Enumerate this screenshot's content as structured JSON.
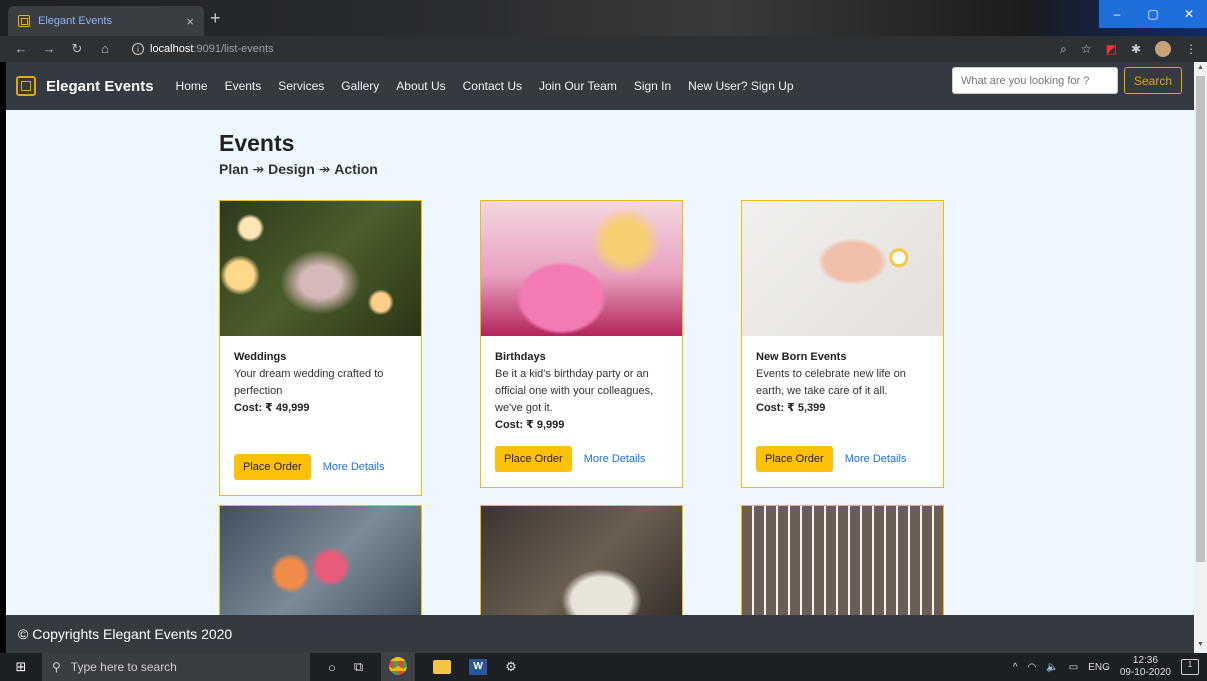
{
  "browser": {
    "tab_title": "Elegant Events",
    "tab_close": "×",
    "new_tab": "+",
    "url_host": "localhost",
    "url_rest": ":9091/list-events",
    "window_controls": [
      "–",
      "▢",
      "✕"
    ]
  },
  "site": {
    "brand": "Elegant Events",
    "nav": [
      "Home",
      "Events",
      "Services",
      "Gallery",
      "About Us",
      "Contact Us",
      "Join Our Team",
      "Sign In",
      "New User? Sign Up"
    ],
    "search_placeholder": "What are you looking for ?",
    "search_button": "Search"
  },
  "page": {
    "title": "Events",
    "subtitle_parts": [
      "Plan",
      "Design",
      "Action"
    ],
    "subtitle_sep": " ↠ "
  },
  "cards": [
    {
      "title": "Weddings",
      "desc": "Your dream wedding crafted to perfection",
      "cost": "Cost: ₹ 49,999",
      "order": "Place Order",
      "more": "More Details"
    },
    {
      "title": "Birthdays",
      "desc": "Be it a kid's birthday party or an official one with your colleagues, we've got it.",
      "cost": "Cost: ₹ 9,999",
      "order": "Place Order",
      "more": "More Details"
    },
    {
      "title": "New Born Events",
      "desc": "Events to celebrate new life on earth, we take care of it all.",
      "cost": "Cost: ₹ 5,399",
      "order": "Place Order",
      "more": "More Details"
    }
  ],
  "footer": {
    "text": "© Copyrights Elegant Events 2020"
  },
  "taskbar": {
    "search_placeholder": "Type here to search",
    "lang": "ENG",
    "time": "12:36",
    "date": "09-10-2020",
    "notif_count": "1"
  },
  "colors": {
    "accent": "#ffc107",
    "nav_bg": "#343a40",
    "page_bg": "#eef6ff",
    "link": "#1a73e8"
  }
}
